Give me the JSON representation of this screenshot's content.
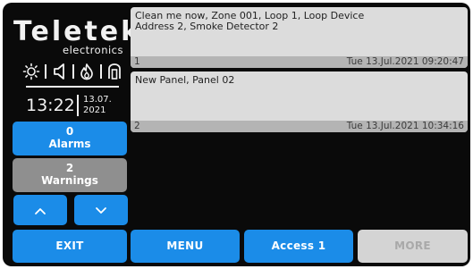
{
  "brand": {
    "name": "Teletek",
    "subtitle": "electronics"
  },
  "status_icons": [
    "sun-icon",
    "speaker-icon",
    "fire-icon",
    "silence-icon"
  ],
  "clock": {
    "time": "13:22",
    "date_day_month": "13.07.",
    "date_year": "2021"
  },
  "counters": {
    "alarms": {
      "count": "0",
      "label": "Alarms"
    },
    "warnings": {
      "count": "2",
      "label": "Warnings"
    }
  },
  "navigation": {
    "up_icon": "chevron-up-icon",
    "down_icon": "chevron-down-icon"
  },
  "events": [
    {
      "line1": "Clean me now, Zone 001, Loop 1, Loop Device",
      "line2": "Address 2, Smoke Detector 2",
      "number": "1",
      "timestamp": "Tue 13.Jul.2021 09:20:47"
    },
    {
      "line1": "New Panel, Panel 02",
      "line2": "",
      "number": "2",
      "timestamp": "Tue 13.Jul.2021 10:34:16"
    }
  ],
  "bottom_bar": {
    "exit": "EXIT",
    "menu": "MENU",
    "access": "Access 1",
    "more": "MORE"
  },
  "colors": {
    "background": "#0a0a0a",
    "button_blue": "#1b8ce8",
    "button_gray": "#8f8f8f",
    "button_disabled": "#d4d4d4",
    "event_bg": "#dcdcdc",
    "event_footer": "#b4b4b4"
  }
}
